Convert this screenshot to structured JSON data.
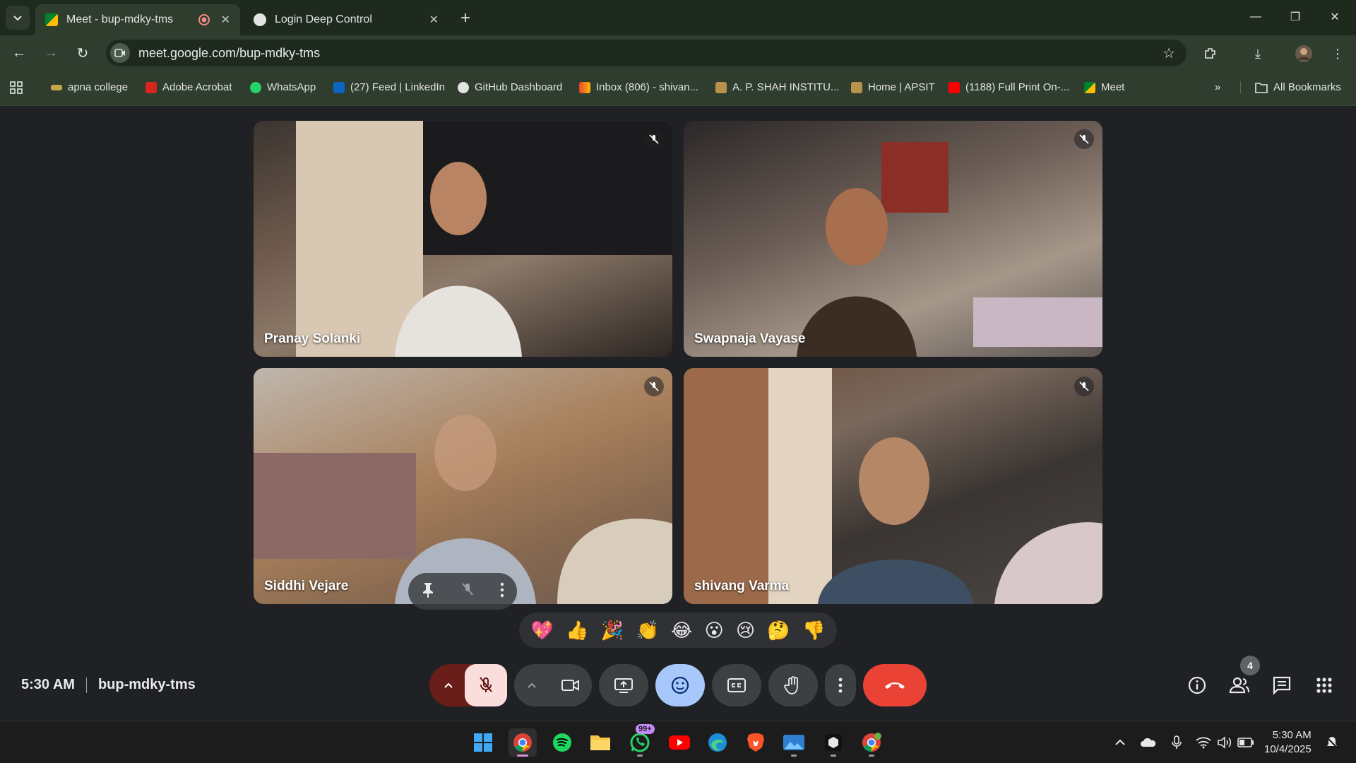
{
  "browser": {
    "tabs": [
      {
        "title": "Meet - bup-mdky-tms",
        "active": true
      },
      {
        "title": "Login Deep Control",
        "active": false
      }
    ],
    "url": "meet.google.com/bup-mdky-tms",
    "bookmarks": [
      {
        "label": "apna college"
      },
      {
        "label": "Adobe Acrobat"
      },
      {
        "label": "WhatsApp"
      },
      {
        "label": "(27) Feed | LinkedIn"
      },
      {
        "label": "GitHub Dashboard"
      },
      {
        "label": "Inbox (806) - shivan..."
      },
      {
        "label": "A. P. SHAH INSTITU..."
      },
      {
        "label": "Home | APSIT"
      },
      {
        "label": "(1188) Full Print On-..."
      },
      {
        "label": "Meet"
      }
    ],
    "all_bookmarks_label": "All Bookmarks"
  },
  "meeting": {
    "participants": [
      {
        "name": "Pranay Solanki",
        "muted": true
      },
      {
        "name": "Swapnaja Vayase",
        "muted": true
      },
      {
        "name": "Siddhi Vejare",
        "muted": true
      },
      {
        "name": "shivang Varma",
        "muted": true
      }
    ],
    "reactions": [
      "💖",
      "👍",
      "🎉",
      "👏",
      "😂",
      "😮",
      "😢",
      "🤔",
      "👎"
    ],
    "time": "5:30 AM",
    "code": "bup-mdky-tms",
    "participant_count": "4"
  },
  "taskbar": {
    "whatsapp_badge": "99+",
    "time": "5:30 AM",
    "date": "10/4/2025"
  },
  "colors": {
    "end_call": "#ea4335",
    "mic_off_bg": "#f9dedc",
    "reactions_active": "#a8c7fa",
    "chrome_frame": "#2f3d2f"
  }
}
